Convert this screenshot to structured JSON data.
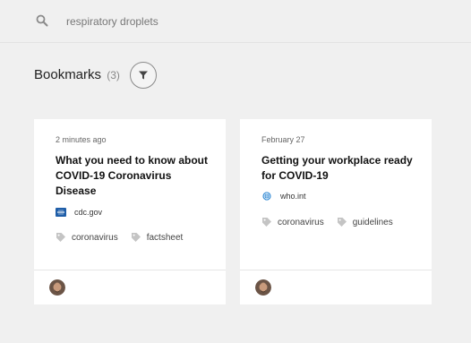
{
  "search": {
    "value": "respiratory droplets",
    "icon": "search-icon"
  },
  "section": {
    "title": "Bookmarks",
    "count": "(3)",
    "filter_icon": "filter-icon"
  },
  "cards": [
    {
      "timestamp": "2 minutes ago",
      "title": "What you need to know about COVID-19 Coronavirus Disease",
      "source": "cdc.gov",
      "source_icon": "cdc-logo-icon",
      "tags": [
        "coronavirus",
        "factsheet"
      ]
    },
    {
      "timestamp": "February 27",
      "title": "Getting your workplace ready for COVID-19",
      "source": "who.int",
      "source_icon": "who-logo-icon",
      "tags": [
        "coronavirus",
        "guidelines"
      ]
    }
  ],
  "colors": {
    "background": "#f0f0f0",
    "card": "#ffffff",
    "tag_icon": "#bdbdbd",
    "cdc_blue": "#1f5ea8",
    "who_blue": "#3a8fd6"
  }
}
